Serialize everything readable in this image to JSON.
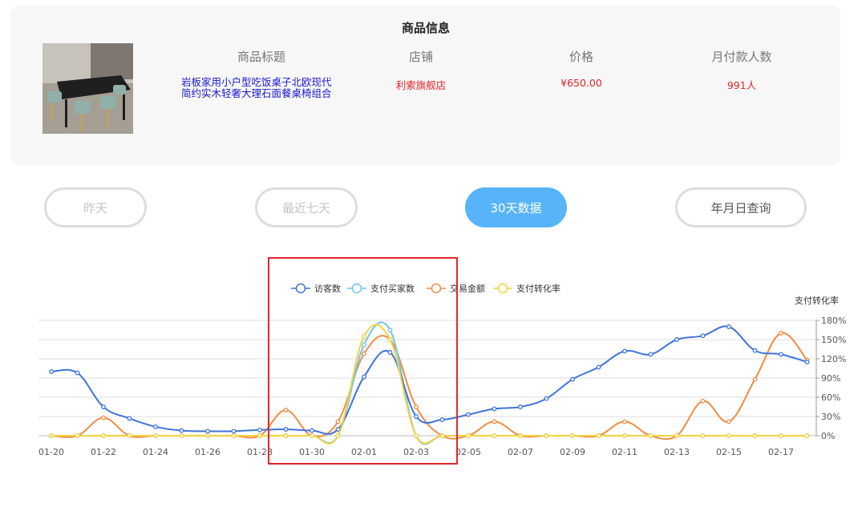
{
  "product": {
    "section_title": "商品信息",
    "headers": [
      "商品标题",
      "店铺",
      "价格",
      "月付款人数"
    ],
    "title_line1": "岩板家用小户型吃饭桌子北欧现代",
    "title_line2": "简约实木轻奢大理石面餐桌椅组合",
    "shop": "利索旗舰店",
    "price": "¥650.00",
    "monthly_buyers": "991人"
  },
  "filters": {
    "yesterday": "昨天",
    "last7": "最近七天",
    "last30": "30天数据",
    "date_query": "年月日查询",
    "active": "last30"
  },
  "colors": {
    "visitors": "#3f74d8",
    "buyers": "#6cc4f4",
    "amount": "#f08c45",
    "conversion": "#f3d23c",
    "active_pill": "#57b4f8",
    "highlight": "#e3262b"
  },
  "chart_data": {
    "type": "line",
    "right_axis_title": "支付转化率",
    "right_axis_ticks": [
      "0%",
      "30%",
      "60%",
      "90%",
      "120%",
      "150%",
      "180%"
    ],
    "ylim": [
      0,
      180
    ],
    "grid": true,
    "legend_position": "top-center",
    "x": [
      "01-20",
      "01-21",
      "01-22",
      "01-23",
      "01-24",
      "01-25",
      "01-26",
      "01-27",
      "01-28",
      "01-29",
      "01-30",
      "01-31",
      "02-01",
      "02-02",
      "02-03",
      "02-04",
      "02-05",
      "02-06",
      "02-07",
      "02-08",
      "02-09",
      "02-10",
      "02-11",
      "02-12",
      "02-13",
      "02-14",
      "02-15",
      "02-16",
      "02-17",
      "02-18"
    ],
    "x_tick_labels": [
      "01-20",
      "01-22",
      "01-24",
      "01-26",
      "01-28",
      "01-30",
      "02-01",
      "02-03",
      "02-05",
      "02-07",
      "02-09",
      "02-11",
      "02-13",
      "02-15",
      "02-17"
    ],
    "series": [
      {
        "name": "访客数",
        "color_key": "visitors",
        "values": [
          100,
          98,
          45,
          27,
          14,
          8,
          7,
          7,
          9,
          10,
          8,
          10,
          92,
          130,
          30,
          25,
          33,
          42,
          45,
          58,
          88,
          107,
          132,
          127,
          150,
          156,
          170,
          133,
          127,
          115
        ]
      },
      {
        "name": "支付买家数",
        "color_key": "buyers",
        "values": [
          0,
          0,
          0,
          0,
          0,
          0,
          0,
          0,
          0,
          0,
          0,
          0,
          142,
          165,
          0,
          0,
          0,
          0,
          0,
          0,
          0,
          0,
          0,
          0,
          0,
          0,
          0,
          0,
          0,
          0
        ]
      },
      {
        "name": "交易金额",
        "color_key": "amount",
        "values": [
          0,
          0,
          28,
          0,
          0,
          0,
          0,
          0,
          0,
          40,
          0,
          22,
          128,
          150,
          45,
          0,
          0,
          22,
          0,
          0,
          0,
          0,
          22,
          0,
          0,
          54,
          22,
          88,
          160,
          118
        ]
      },
      {
        "name": "支付转化率",
        "color_key": "conversion",
        "values": [
          0,
          0,
          0,
          0,
          0,
          0,
          0,
          0,
          0,
          0,
          0,
          0,
          155,
          150,
          0,
          0,
          0,
          0,
          0,
          0,
          0,
          0,
          0,
          0,
          0,
          0,
          0,
          0,
          0,
          0
        ]
      }
    ]
  }
}
